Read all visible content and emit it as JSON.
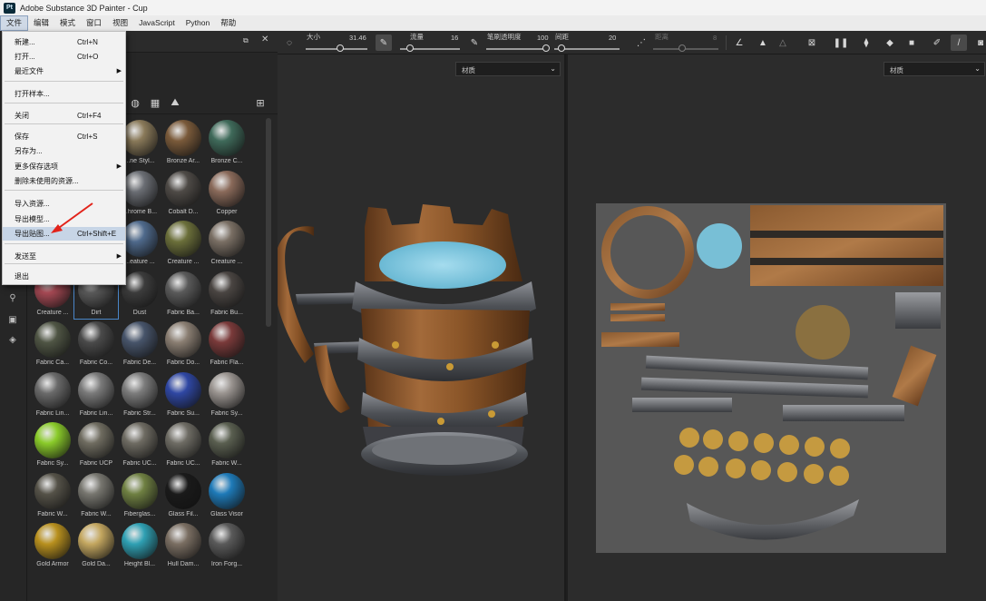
{
  "window": {
    "title": "Adobe Substance 3D Painter - Cup",
    "logo": "Pt"
  },
  "menubar": [
    "文件",
    "编辑",
    "模式",
    "窗口",
    "视图",
    "JavaScript",
    "Python",
    "帮助"
  ],
  "toolbar": {
    "size_label": "大小",
    "size_value": "31.46",
    "flow_label": "流量",
    "flow_value": "16",
    "opacity_label": "笔刷透明度",
    "opacity_value": "100",
    "spacing_label": "间距",
    "spacing_value": "20",
    "distance_label": "距离",
    "distance_value": "8"
  },
  "file_menu": {
    "items": [
      {
        "label": "新建...",
        "shortcut": "Ctrl+N"
      },
      {
        "label": "打开...",
        "shortcut": "Ctrl+O"
      },
      {
        "label": "最近文件",
        "submenu": "▶"
      },
      {
        "label": "打开样本..."
      },
      {
        "label": "关闭",
        "shortcut": "Ctrl+F4"
      },
      {
        "label": "保存",
        "shortcut": "Ctrl+S"
      },
      {
        "label": "另存为..."
      },
      {
        "label": "更多保存选项",
        "submenu": "▶"
      },
      {
        "label": "删除未使用的资源..."
      },
      {
        "label": "导入资源..."
      },
      {
        "label": "导出模型..."
      },
      {
        "label": "导出贴图...",
        "shortcut": "Ctrl+Shift+E"
      },
      {
        "label": "发送至",
        "submenu": "▶"
      },
      {
        "label": "退出"
      }
    ]
  },
  "viewport3d": {
    "mode": "材质"
  },
  "viewport2d": {
    "mode": "材质"
  },
  "materials": [
    [
      "",
      "...ne Styl...",
      "Bronze Ar...",
      "Bronze C..."
    ],
    [
      "",
      "...hrome B...",
      "Cobalt D...",
      "Copper"
    ],
    [
      "",
      "...eature ...",
      "Creature ...",
      "Creature ..."
    ],
    [
      "Creature ...",
      "Dirt",
      "Dust",
      "Fabric Ba...",
      "Fabric Bu..."
    ],
    [
      "Fabric Ca...",
      "Fabric Co...",
      "Fabric De...",
      "Fabric Do...",
      "Fabric Fla..."
    ],
    [
      "Fabric Lin...",
      "Fabric Lin...",
      "Fabric Str...",
      "Fabric Su...",
      "Fabric Sy..."
    ],
    [
      "Fabric Sy...",
      "Fabric UCP",
      "Fabric UC...",
      "Fabric UC...",
      "Fabric W..."
    ],
    [
      "Fabric W...",
      "Fabric W...",
      "Fiberglas...",
      "Glass Fil...",
      "Glass Visor"
    ],
    [
      "Gold Armor",
      "Gold Da...",
      "Height Bl...",
      "Hull Dam...",
      "Iron Forg..."
    ]
  ],
  "icons": {
    "left_strip": [
      "layers-icon",
      "shelf-icon",
      "material-icon"
    ],
    "filters": [
      "sphere-filter-icon",
      "grid-filter-icon",
      "image-filter-icon",
      "view-grid-icon"
    ]
  },
  "colors": {
    "menu_highlight": "#c7d5e6",
    "selection": "#4a86c8",
    "annotation_arrow": "#e2231a"
  }
}
